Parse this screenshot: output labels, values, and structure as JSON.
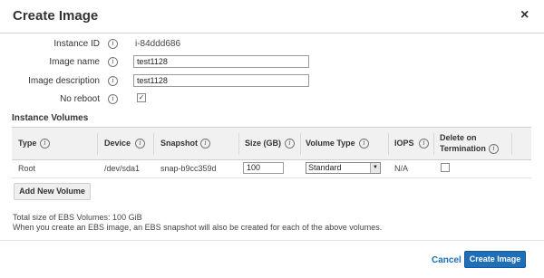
{
  "dialog": {
    "title": "Create Image",
    "close_glyph": "×"
  },
  "form": {
    "instance_id_label": "Instance ID",
    "instance_id_value": "i-84ddd686",
    "image_name_label": "Image name",
    "image_name_value": "test1128",
    "image_description_label": "Image description",
    "image_description_value": "test1128",
    "no_reboot_label": "No reboot",
    "no_reboot_checked": true
  },
  "volumes": {
    "section_title": "Instance Volumes",
    "columns": [
      "Type",
      "Device",
      "Snapshot",
      "Size (GB)",
      "Volume Type",
      "IOPS",
      "Delete on",
      "Termination"
    ],
    "row": {
      "type": "Root",
      "device": "/dev/sda1",
      "snapshot": "snap-b9cc359d",
      "size": "100",
      "volume_type": "Standard",
      "iops": "N/A",
      "delete_on_termination": false
    },
    "add_button": "Add New Volume"
  },
  "notes": {
    "total_size": "Total size of EBS Volumes: 100 GiB",
    "snapshot_note": "When you create an EBS image, an EBS snapshot will also be created for each of the above volumes."
  },
  "footer": {
    "cancel_label": "Cancel",
    "create_label": "Create Image"
  },
  "icons": {
    "info": "i",
    "check": "✓",
    "dropdown": "▼"
  },
  "colors": {
    "primary": "#1f6fb8",
    "link": "#1a6fb5"
  }
}
